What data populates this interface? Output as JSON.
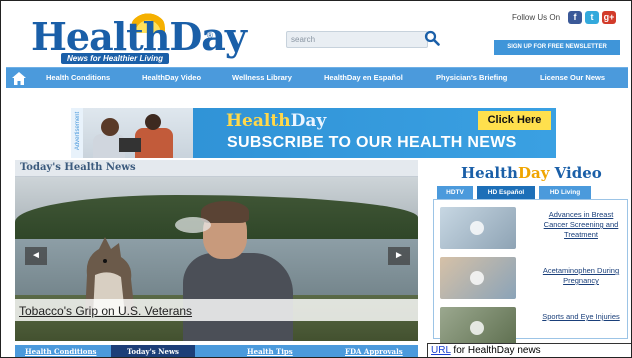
{
  "logo": {
    "health": "Health",
    "day": "Day",
    "tagline": "News for Healthier Living",
    "reg": "®"
  },
  "search": {
    "placeholder": "search"
  },
  "social": {
    "follow_label": "Follow Us On",
    "facebook": "f",
    "twitter": "t",
    "google": "g+"
  },
  "newsletter_label": "SIGN UP FOR FREE NEWSLETTER",
  "nav": {
    "items": [
      "Health Conditions",
      "HealthDay Video",
      "Wellness Library",
      "HealthDay en Español",
      "Physician's Briefing",
      "License Our News"
    ]
  },
  "banner": {
    "ad_label": "Advertisement",
    "brand_health": "Health",
    "brand_day": "Day",
    "subtitle": "SUBSCRIBE TO OUR HEALTH NEWS",
    "cta": "Click Here"
  },
  "news": {
    "title": "Today's Health News",
    "headline": "Tobacco's Grip on U.S. Veterans",
    "prev": "◄",
    "next": "►",
    "bottom_tabs": [
      "Health Conditions",
      "Today's News",
      "Health Tips",
      "FDA Approvals"
    ]
  },
  "video": {
    "title_health": "Health",
    "title_day": "Day",
    "title_rest": " Video",
    "tabs": [
      "HDTV",
      "HD Español",
      "HD Living"
    ],
    "items": [
      "Advances in Breast Cancer Screening and Treatment",
      "Acetaminophen During Pregnancy",
      "Sports and Eye Injuries"
    ]
  },
  "note": {
    "link": "URL",
    "text": " for HealthDay news"
  },
  "colors": {
    "brand_blue": "#1a5fa8",
    "nav_blue": "#4b9adc",
    "accent_yellow": "#ffe04d"
  }
}
